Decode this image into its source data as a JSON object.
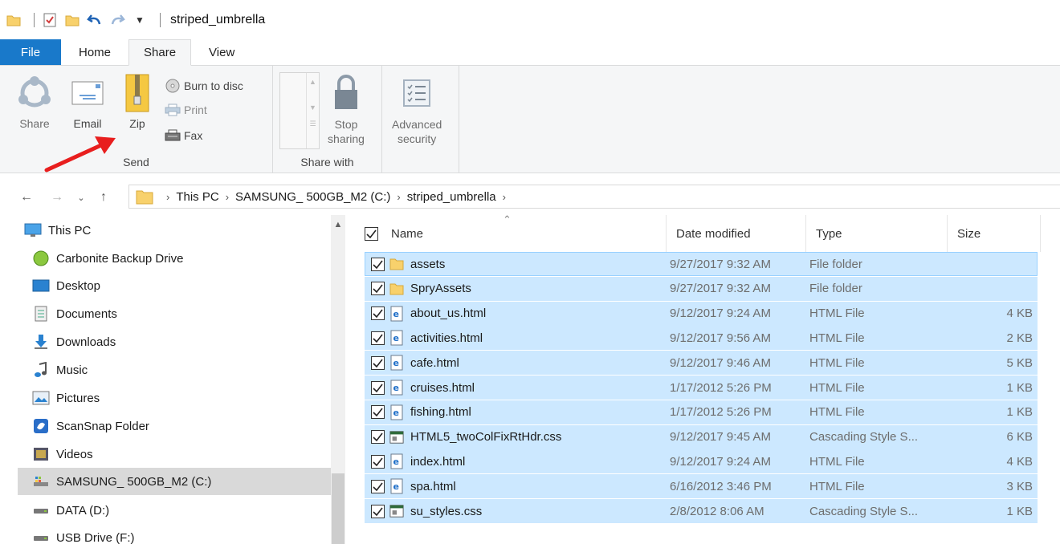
{
  "window": {
    "title": "striped_umbrella"
  },
  "tabs": [
    "File",
    "Home",
    "Share",
    "View"
  ],
  "ribbon": {
    "send": {
      "label": "Send",
      "share": "Share",
      "email": "Email",
      "zip": "Zip",
      "burn": "Burn to disc",
      "print": "Print",
      "fax": "Fax"
    },
    "share_with": {
      "label": "Share with",
      "stop_line1": "Stop",
      "stop_line2": "sharing",
      "adv_line1": "Advanced",
      "adv_line2": "security"
    }
  },
  "address": {
    "crumbs": [
      "This PC",
      "SAMSUNG_ 500GB_M2 (C:)",
      "striped_umbrella"
    ]
  },
  "nav": {
    "items": [
      {
        "label": "This PC",
        "icon": "monitor-icon"
      },
      {
        "label": "Carbonite Backup Drive",
        "icon": "carbonite-icon"
      },
      {
        "label": "Desktop",
        "icon": "desktop-icon"
      },
      {
        "label": "Documents",
        "icon": "documents-icon"
      },
      {
        "label": "Downloads",
        "icon": "downloads-icon"
      },
      {
        "label": "Music",
        "icon": "music-icon"
      },
      {
        "label": "Pictures",
        "icon": "pictures-icon"
      },
      {
        "label": "ScanSnap Folder",
        "icon": "scansnap-icon"
      },
      {
        "label": "Videos",
        "icon": "videos-icon"
      },
      {
        "label": "SAMSUNG_ 500GB_M2 (C:)",
        "icon": "drive-icon",
        "selected": true
      },
      {
        "label": "DATA (D:)",
        "icon": "drive-icon"
      },
      {
        "label": "USB Drive (F:)",
        "icon": "usb-drive-icon"
      }
    ]
  },
  "columns": {
    "name": "Name",
    "date": "Date modified",
    "type": "Type",
    "size": "Size"
  },
  "files": [
    {
      "name": "assets",
      "date": "9/27/2017 9:32 AM",
      "type": "File folder",
      "size": "",
      "icon": "folder-icon"
    },
    {
      "name": "SpryAssets",
      "date": "9/27/2017 9:32 AM",
      "type": "File folder",
      "size": "",
      "icon": "folder-icon"
    },
    {
      "name": "about_us.html",
      "date": "9/12/2017 9:24 AM",
      "type": "HTML File",
      "size": "4 KB",
      "icon": "html-file-icon"
    },
    {
      "name": "activities.html",
      "date": "9/12/2017 9:56 AM",
      "type": "HTML File",
      "size": "2 KB",
      "icon": "html-file-icon"
    },
    {
      "name": "cafe.html",
      "date": "9/12/2017 9:46 AM",
      "type": "HTML File",
      "size": "5 KB",
      "icon": "html-file-icon"
    },
    {
      "name": "cruises.html",
      "date": "1/17/2012 5:26 PM",
      "type": "HTML File",
      "size": "1 KB",
      "icon": "html-file-icon"
    },
    {
      "name": "fishing.html",
      "date": "1/17/2012 5:26 PM",
      "type": "HTML File",
      "size": "1 KB",
      "icon": "html-file-icon"
    },
    {
      "name": "HTML5_twoColFixRtHdr.css",
      "date": "9/12/2017 9:45 AM",
      "type": "Cascading Style S...",
      "size": "6 KB",
      "icon": "css-file-icon"
    },
    {
      "name": "index.html",
      "date": "9/12/2017 9:24 AM",
      "type": "HTML File",
      "size": "4 KB",
      "icon": "html-file-icon"
    },
    {
      "name": "spa.html",
      "date": "6/16/2012 3:46 PM",
      "type": "HTML File",
      "size": "3 KB",
      "icon": "html-file-icon"
    },
    {
      "name": "su_styles.css",
      "date": "2/8/2012 8:06 AM",
      "type": "Cascading Style S...",
      "size": "1 KB",
      "icon": "css-file-icon"
    }
  ],
  "colors": {
    "selection": "#cce8ff",
    "file_tab": "#1979ca",
    "annotation_arrow": "#e81e1e"
  }
}
